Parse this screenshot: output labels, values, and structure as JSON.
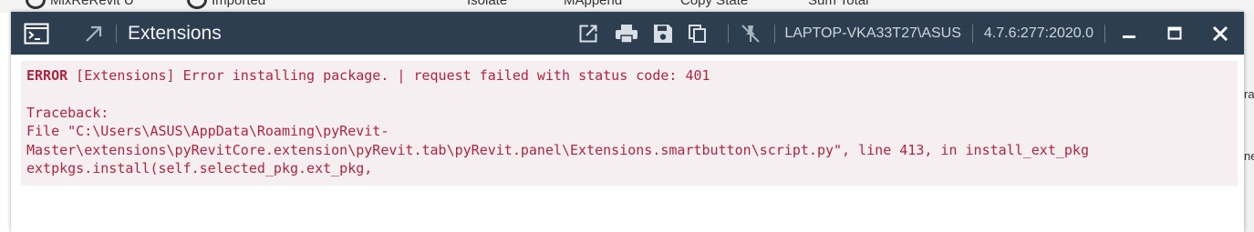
{
  "window": {
    "title": "Extensions",
    "machine": "LAPTOP-VKA33T27\\ASUS",
    "version": "4.7.6:277:2020.0"
  },
  "background": {
    "ribbon_labels": [
      "Imported",
      "Isolate",
      "MAppend",
      "Copy State",
      "Sum Total"
    ]
  },
  "icons": {
    "console": "console-icon",
    "expand": "expand-arrow-icon",
    "open_external": "open-external-icon",
    "print": "print-icon",
    "save": "save-icon",
    "copy": "copy-icon",
    "pin": "pin-icon",
    "minimize": "minimize-icon",
    "maximize": "maximize-icon",
    "close": "close-icon"
  },
  "log": {
    "level": "ERROR",
    "message": " [Extensions] Error installing package. | request failed with status code: 401",
    "traceback_label": "Traceback:",
    "traceback_lines": [
      "File \"C:\\Users\\ASUS\\AppData\\Roaming\\pyRevit-",
      "Master\\extensions\\pyRevitCore.extension\\pyRevit.tab\\pyRevit.panel\\Extensions.smartbutton\\script.py\", line 413, in install_ext_pkg",
      "extpkgs.install(self.selected_pkg.ext_pkg,"
    ]
  },
  "colors": {
    "titlebar": "#2d3e50",
    "error_text": "#b0243f",
    "error_background": "#f5eff2"
  }
}
